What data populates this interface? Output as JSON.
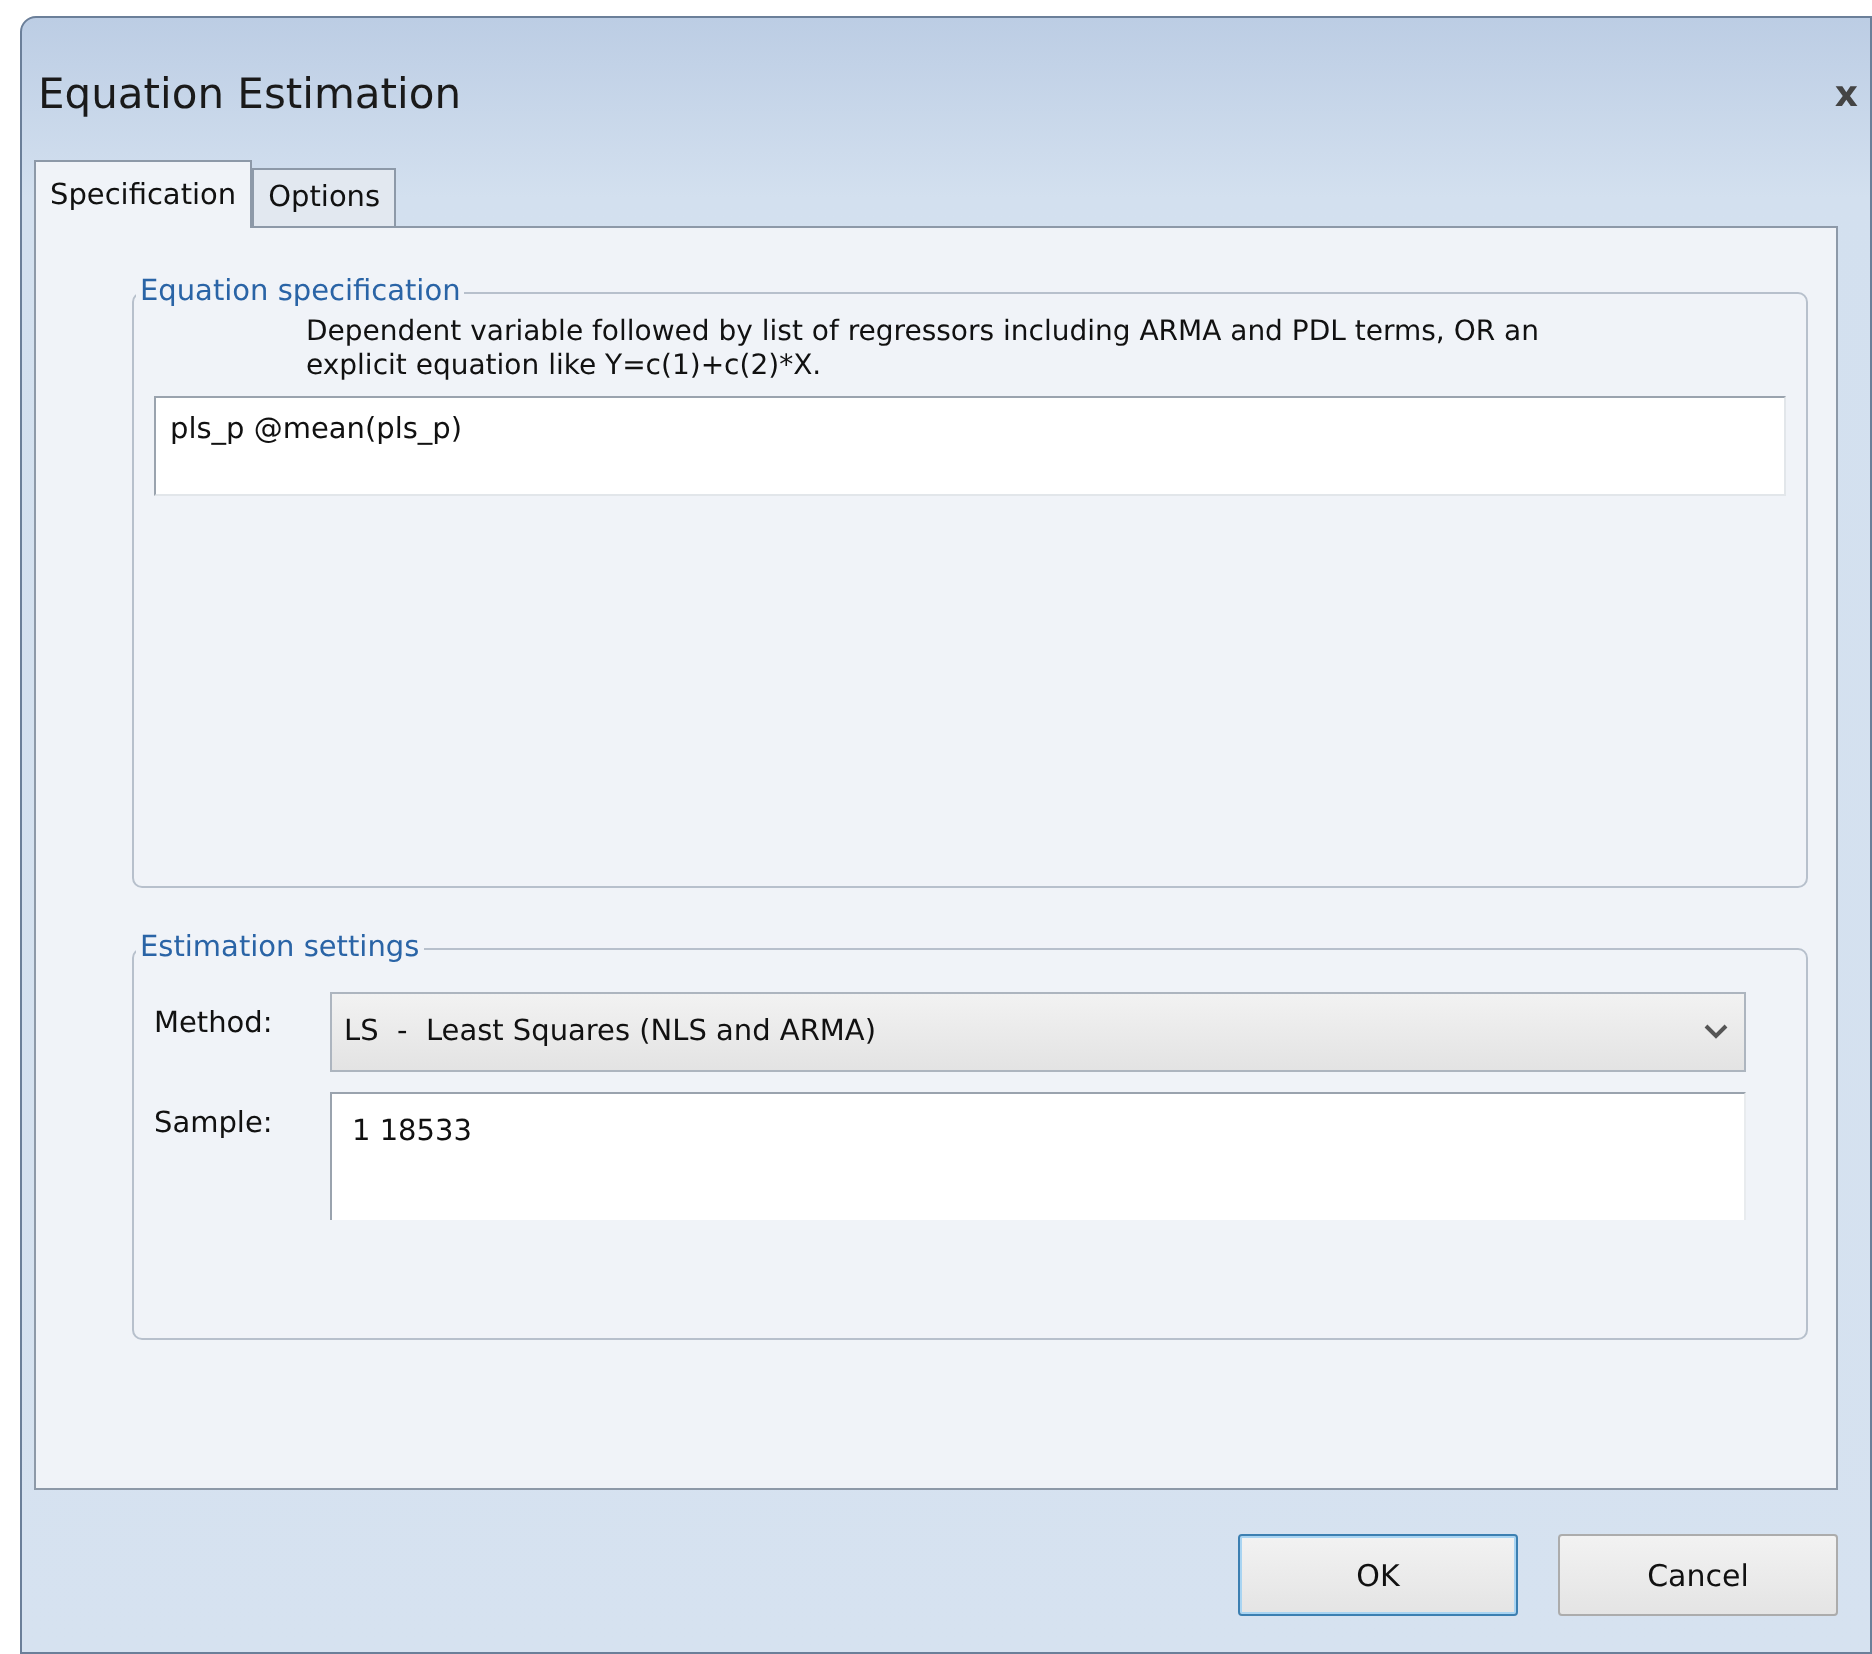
{
  "window": {
    "title": "Equation Estimation",
    "close": "x"
  },
  "tabs": [
    {
      "label": "Specification",
      "selected": true
    },
    {
      "label": "Options",
      "selected": false
    }
  ],
  "equation_specification": {
    "legend": "Equation specification",
    "description": "Dependent variable followed by list of regressors including ARMA and PDL terms, OR an explicit equation like Y=c(1)+c(2)*X.",
    "value": "pls_p @mean(pls_p)"
  },
  "estimation_settings": {
    "legend": "Estimation settings",
    "method_label": "Method:",
    "method_value": "LS  -  Least Squares (NLS and ARMA)",
    "sample_label": "Sample:",
    "sample_value": "1 18533"
  },
  "buttons": [
    {
      "label": "OK",
      "default": true
    },
    {
      "label": "Cancel",
      "default": false
    }
  ]
}
